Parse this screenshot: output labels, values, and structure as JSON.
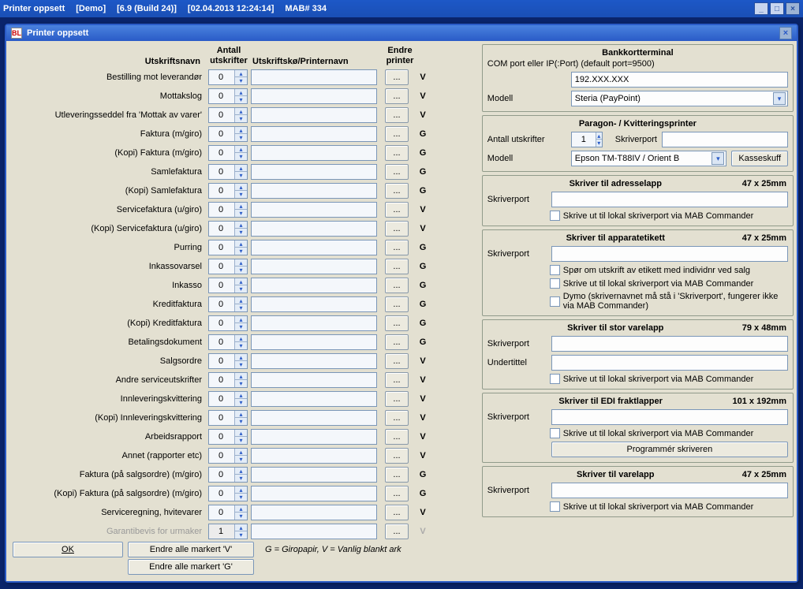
{
  "outer_title": {
    "seg1": "Printer oppsett",
    "seg2": "[Demo]",
    "seg3": "[6.9 (Build 24)]",
    "seg4": "[02.04.2013   12:24:14]",
    "seg5": "MAB# 334"
  },
  "inner_title": "Printer oppsett",
  "headers": {
    "name": "Utskriftsnavn",
    "count": "Antall utskrifter",
    "queue": "Utskriftskø/Printernavn",
    "change": "Endre printer"
  },
  "rows": [
    {
      "name": "Bestilling mot leverandør",
      "count": "0",
      "marker": "V"
    },
    {
      "name": "Mottakslog",
      "count": "0",
      "marker": "V"
    },
    {
      "name": "Utleveringsseddel fra 'Mottak av varer'",
      "count": "0",
      "marker": "V"
    },
    {
      "name": "Faktura (m/giro)",
      "count": "0",
      "marker": "G"
    },
    {
      "name": "(Kopi) Faktura (m/giro)",
      "count": "0",
      "marker": "G"
    },
    {
      "name": "Samlefaktura",
      "count": "0",
      "marker": "G"
    },
    {
      "name": "(Kopi) Samlefaktura",
      "count": "0",
      "marker": "G"
    },
    {
      "name": "Servicefaktura (u/giro)",
      "count": "0",
      "marker": "V"
    },
    {
      "name": "(Kopi) Servicefaktura (u/giro)",
      "count": "0",
      "marker": "V"
    },
    {
      "name": "Purring",
      "count": "0",
      "marker": "G"
    },
    {
      "name": "Inkassovarsel",
      "count": "0",
      "marker": "G"
    },
    {
      "name": "Inkasso",
      "count": "0",
      "marker": "G"
    },
    {
      "name": "Kreditfaktura",
      "count": "0",
      "marker": "G"
    },
    {
      "name": "(Kopi) Kreditfaktura",
      "count": "0",
      "marker": "G"
    },
    {
      "name": "Betalingsdokument",
      "count": "0",
      "marker": "G"
    },
    {
      "name": "Salgsordre",
      "count": "0",
      "marker": "V"
    },
    {
      "name": "Andre serviceutskrifter",
      "count": "0",
      "marker": "V"
    },
    {
      "name": "Innleveringskvittering",
      "count": "0",
      "marker": "V"
    },
    {
      "name": "(Kopi) Innleveringskvittering",
      "count": "0",
      "marker": "V"
    },
    {
      "name": "Arbeidsrapport",
      "count": "0",
      "marker": "V"
    },
    {
      "name": "Annet (rapporter etc)",
      "count": "0",
      "marker": "V"
    },
    {
      "name": "Faktura (på salgsordre) (m/giro)",
      "count": "0",
      "marker": "G"
    },
    {
      "name": "(Kopi) Faktura (på salgsordre) (m/giro)",
      "count": "0",
      "marker": "G"
    },
    {
      "name": "Serviceregning, hvitevarer",
      "count": "0",
      "marker": "V"
    },
    {
      "name": "Garantibevis for urmaker",
      "count": "1",
      "marker": "V",
      "disabled": true
    }
  ],
  "footer": {
    "ok": "OK",
    "btn_v": "Endre alle markert 'V'",
    "btn_g": "Endre alle markert 'G'",
    "note": "G = Giropapir, V = Vanlig blankt ark"
  },
  "right": {
    "bank": {
      "title": "Bankkortterminal",
      "port_label": "COM port eller IP(:Port) (default port=9500)",
      "port_value": "192.XXX.XXX",
      "modell_label": "Modell",
      "modell_value": "Steria (PayPoint)"
    },
    "paragon": {
      "title": "Paragon- / Kvitteringsprinter",
      "antall_label": "Antall utskrifter",
      "antall_value": "1",
      "skriverport_label": "Skriverport",
      "modell_label": "Modell",
      "modell_value": "Epson TM-T88IV / Orient B",
      "kasseskuff": "Kasseskuff"
    },
    "adresse": {
      "title": "Skriver til adresselapp",
      "size": "47 x 25mm",
      "skriverport_label": "Skriverport",
      "chk1": "Skrive ut til lokal skriverport via MAB Commander"
    },
    "apparat": {
      "title": "Skriver til apparatetikett",
      "size": "47 x 25mm",
      "skriverport_label": "Skriverport",
      "chk1": "Spør om utskrift av etikett med individnr ved salg",
      "chk2": "Skrive ut til lokal skriverport via MAB Commander",
      "chk3": "Dymo (skrivernavnet må stå i 'Skriverport', fungerer ikke via MAB Commander)"
    },
    "storvare": {
      "title": "Skriver til stor varelapp",
      "size": "79 x 48mm",
      "skriverport_label": "Skriverport",
      "undertittel_label": "Undertittel",
      "chk1": "Skrive ut til lokal skriverport via MAB Commander"
    },
    "edi": {
      "title": "Skriver til EDI fraktlapper",
      "size": "101 x 192mm",
      "skriverport_label": "Skriverport",
      "chk1": "Skrive ut til lokal skriverport via MAB Commander",
      "prog_btn": "Programmér skriveren"
    },
    "vare": {
      "title": "Skriver til varelapp",
      "size": "47 x 25mm",
      "skriverport_label": "Skriverport",
      "chk1": "Skrive ut til lokal skriverport via MAB Commander"
    }
  }
}
